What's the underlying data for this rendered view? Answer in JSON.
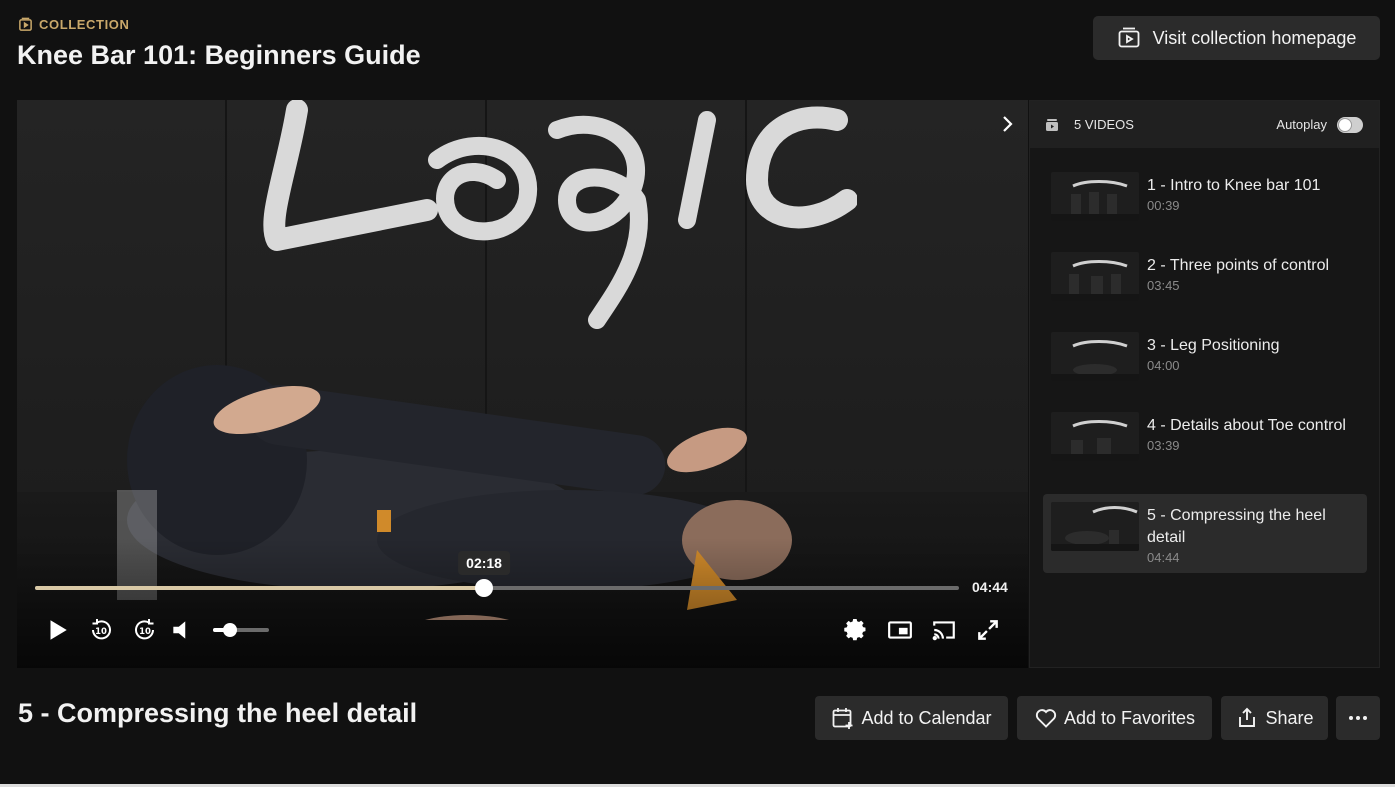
{
  "header": {
    "collection_label": "COLLECTION",
    "title": "Knee Bar 101: Beginners Guide",
    "visit_button": "Visit collection homepage"
  },
  "player": {
    "brand_mark": "Logic",
    "progress_fraction": 0.486,
    "current_time": "02:18",
    "duration": "04:44",
    "volume_fraction": 0.3,
    "controls": [
      "play-icon",
      "rewind-10-icon",
      "forward-10-icon",
      "volume-icon",
      "settings-icon",
      "picture-in-picture-icon",
      "cast-icon",
      "fullscreen-icon"
    ]
  },
  "playlist": {
    "count_label": "5 VIDEOS",
    "autoplay_label": "Autoplay",
    "autoplay_on": false,
    "items": [
      {
        "title": "1 - Intro to Knee bar 101",
        "duration": "00:39",
        "active": false
      },
      {
        "title": "2 - Three points of control",
        "duration": "03:45",
        "active": false
      },
      {
        "title": "3 - Leg Positioning",
        "duration": "04:00",
        "active": false
      },
      {
        "title": "4 - Details about Toe control",
        "duration": "03:39",
        "active": false
      },
      {
        "title": "5 - Compressing the heel detail",
        "duration": "04:44",
        "active": true
      }
    ]
  },
  "video": {
    "title": "5 - Compressing the heel detail"
  },
  "actions": {
    "add_to_calendar": "Add to Calendar",
    "add_to_favorites": "Add to Favorites",
    "share": "Share",
    "more": "more-options-icon"
  },
  "colors": {
    "accent_gold": "#c9a86a",
    "background": "#111111",
    "button_bg": "#2b2b2b",
    "progress_fill": "#d9c9a6"
  }
}
